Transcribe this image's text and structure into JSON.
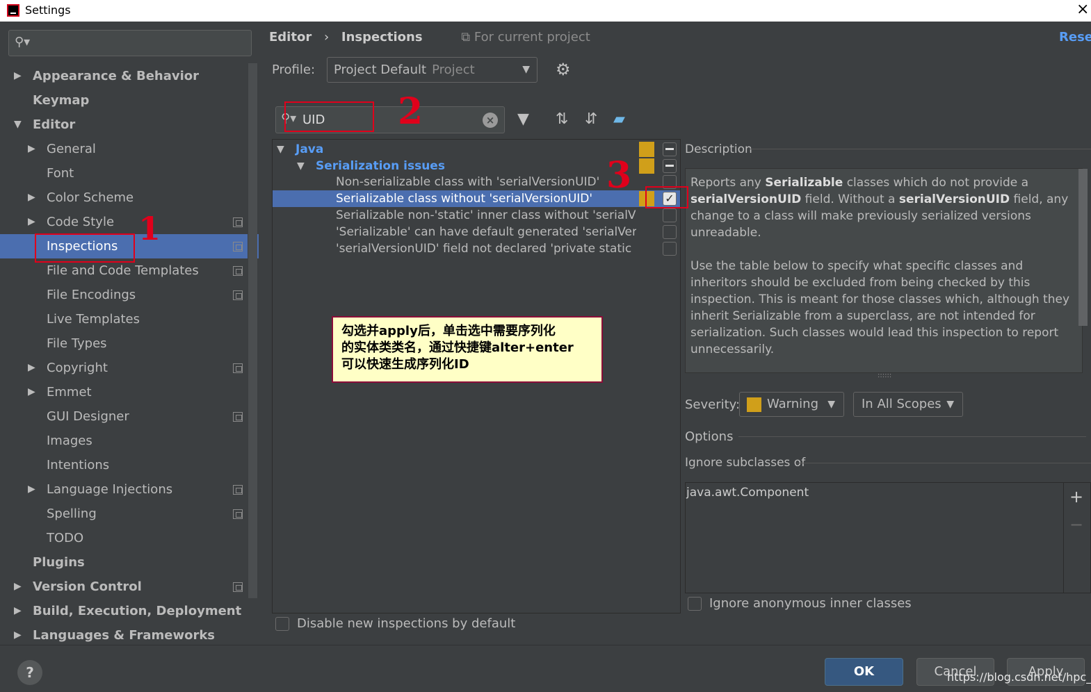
{
  "window": {
    "title": "Settings",
    "close_icon": "×"
  },
  "sidebar": {
    "search_placeholder": "",
    "items": [
      {
        "label": "Appearance & Behavior",
        "level": 0,
        "expandable": true,
        "expanded": false,
        "bold": true
      },
      {
        "label": "Keymap",
        "level": 0,
        "bold": true
      },
      {
        "label": "Editor",
        "level": 0,
        "expandable": true,
        "expanded": true,
        "bold": true
      },
      {
        "label": "General",
        "level": 1,
        "expandable": true
      },
      {
        "label": "Font",
        "level": 1
      },
      {
        "label": "Color Scheme",
        "level": 1,
        "expandable": true
      },
      {
        "label": "Code Style",
        "level": 1,
        "expandable": true,
        "project_icon": true
      },
      {
        "label": "Inspections",
        "level": 1,
        "selected": true,
        "project_icon": true
      },
      {
        "label": "File and Code Templates",
        "level": 1,
        "project_icon": true
      },
      {
        "label": "File Encodings",
        "level": 1,
        "project_icon": true
      },
      {
        "label": "Live Templates",
        "level": 1
      },
      {
        "label": "File Types",
        "level": 1
      },
      {
        "label": "Copyright",
        "level": 1,
        "expandable": true,
        "project_icon": true
      },
      {
        "label": "Emmet",
        "level": 1,
        "expandable": true
      },
      {
        "label": "GUI Designer",
        "level": 1,
        "project_icon": true
      },
      {
        "label": "Images",
        "level": 1
      },
      {
        "label": "Intentions",
        "level": 1
      },
      {
        "label": "Language Injections",
        "level": 1,
        "expandable": true,
        "project_icon": true
      },
      {
        "label": "Spelling",
        "level": 1,
        "project_icon": true
      },
      {
        "label": "TODO",
        "level": 1
      },
      {
        "label": "Plugins",
        "level": 0,
        "bold": true
      },
      {
        "label": "Version Control",
        "level": 0,
        "expandable": true,
        "bold": true,
        "project_icon": true
      },
      {
        "label": "Build, Execution, Deployment",
        "level": 0,
        "expandable": true,
        "bold": true
      },
      {
        "label": "Languages & Frameworks",
        "level": 0,
        "expandable": true,
        "bold": true
      }
    ]
  },
  "header": {
    "breadcrumb_editor": "Editor",
    "breadcrumb_sep": "›",
    "breadcrumb_inspections": "Inspections",
    "for_current_project": "For current project",
    "reset": "Reset"
  },
  "profile": {
    "label": "Profile:",
    "value": "Project Default",
    "sub": "Project"
  },
  "filter": {
    "value": "UID"
  },
  "inspections": {
    "group": "Java",
    "subgroup": "Serialization issues",
    "items": [
      {
        "label": "Non-serializable class with 'serialVersionUID'",
        "checked": false
      },
      {
        "label": "Serializable class without 'serialVersionUID'",
        "checked": true,
        "selected": true
      },
      {
        "label": "Serializable non-'static' inner class without 'serialV",
        "checked": false
      },
      {
        "label": "'Serializable' can have default generated 'serialVer",
        "checked": false
      },
      {
        "label": "'serialVersionUID' field not declared 'private static",
        "checked": false
      }
    ],
    "disable_new": "Disable new inspections by default"
  },
  "note": {
    "line1": "勾选并apply后，单击选中需要序列化",
    "line2": "的实体类类名，通过快捷键alter+enter",
    "line3": "可以快速生成序列化ID"
  },
  "annotations": {
    "mark1": "1",
    "mark2": "2",
    "mark3": "3"
  },
  "description": {
    "title": "Description",
    "p1_a": "Reports any ",
    "p1_b": "Serializable",
    "p1_c": " classes which do not provide a ",
    "p1_d": "serialVersionUID",
    "p1_e": " field. Without a ",
    "p1_f": "serialVersionUID",
    "p1_g": " field, any change to a class will make previously serialized versions unreadable.",
    "p2": "Use the table below to specify what specific classes and inheritors should be excluded from being checked by this inspection. This is meant for those classes which, although they inherit Serializable from a superclass, are not intended for serialization. Such classes would lead this inspection to report unnecessarily."
  },
  "severity": {
    "label": "Severity:",
    "value": "Warning",
    "scope": "In All Scopes",
    "color": "#d09f1a"
  },
  "options": {
    "title": "Options",
    "ignore_subclasses": "Ignore subclasses of",
    "list": [
      "java.awt.Component"
    ],
    "ignore_anonymous": "Ignore anonymous inner classes"
  },
  "footer": {
    "help": "?",
    "ok": "OK",
    "cancel": "Cancel",
    "apply": "Apply",
    "watermark": "https://blog.csdn.net/hpc_er"
  },
  "colors": {
    "accent": "#4b6eaf",
    "link": "#589df6",
    "annotation": "#e0001b"
  },
  "icons": [
    "search-icon",
    "gear-icon",
    "filter-icon",
    "expand-all-icon",
    "collapse-all-icon",
    "eraser-icon",
    "clear-icon",
    "copy-project-icon"
  ]
}
